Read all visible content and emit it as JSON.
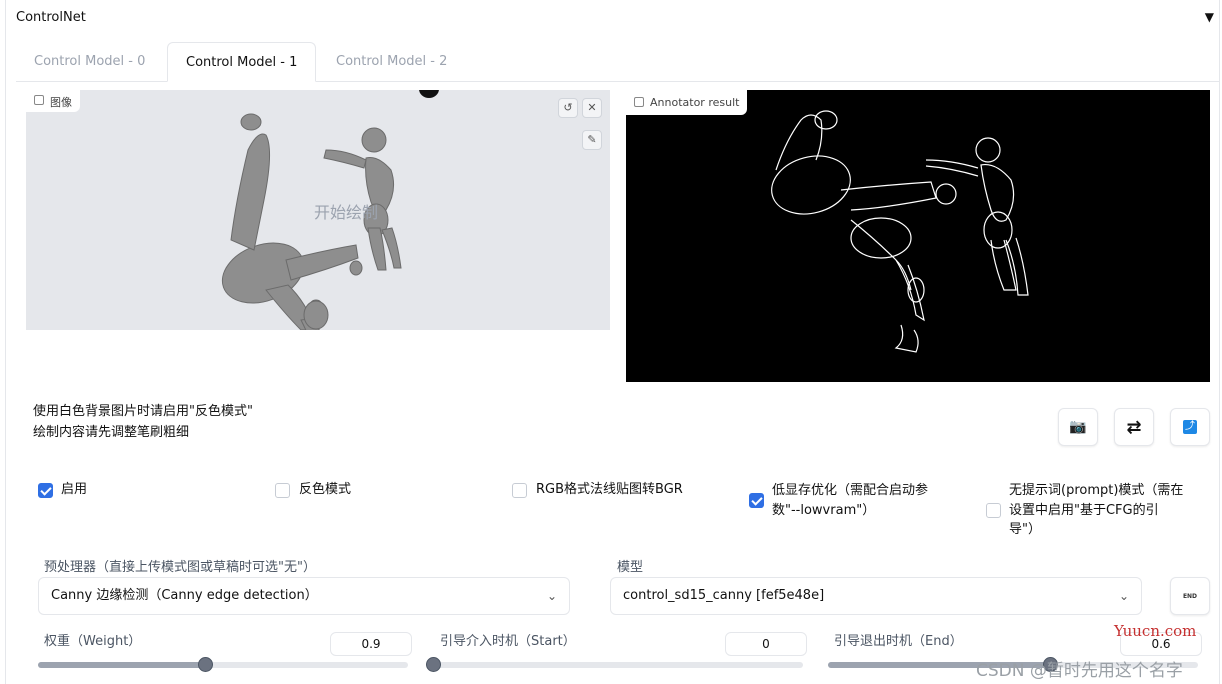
{
  "panel": {
    "title": "ControlNet",
    "collapse_arrow": "▼"
  },
  "tabs": [
    {
      "label": "Control Model - 0",
      "active": false
    },
    {
      "label": "Control Model - 1",
      "active": true
    },
    {
      "label": "Control Model - 2",
      "active": false
    }
  ],
  "image_input": {
    "label": "图像",
    "canvas_hint": "开始绘制",
    "buttons": {
      "undo": "↺",
      "clear": "✕",
      "brush": "✎"
    }
  },
  "annotator": {
    "label": "Annotator result"
  },
  "hints": {
    "line1": "使用白色背景图片时请启用\"反色模式\"",
    "line2": "绘制内容请先调整笔刷粗细"
  },
  "action_buttons": {
    "camera": "📷",
    "swap": "⇄",
    "send": "⤴"
  },
  "checkboxes": [
    {
      "label": "启用",
      "checked": true
    },
    {
      "label": "反色模式",
      "checked": false
    },
    {
      "label": "RGB格式法线贴图转BGR",
      "checked": false
    },
    {
      "label_line1": "低显存优化（需配合启动参",
      "label_line2": "数\"--lowvram\"）",
      "checked": true
    },
    {
      "label_line1": "无提示词(prompt)模式（需在",
      "label_line2": "设置中启用\"基于CFG的引",
      "label_line3": "导\"）",
      "checked": false
    }
  ],
  "preprocessor": {
    "label": "预处理器（直接上传模式图或草稿时可选\"无\"）",
    "value": "Canny 边缘检测（Canny edge detection）"
  },
  "model": {
    "label": "模型",
    "value": "control_sd15_canny [fef5e48e]",
    "refresh_icon": "END"
  },
  "sliders": {
    "weight": {
      "label": "权重（Weight）",
      "value": "0.9",
      "fraction": 0.45
    },
    "start": {
      "label": "引导介入时机（Start）",
      "value": "0",
      "fraction": 0.0
    },
    "end": {
      "label": "引导退出时机（End）",
      "value": "0.6",
      "fraction": 0.6
    }
  },
  "watermark": {
    "site": "Yuucn.com",
    "credit": "CSDN @暂时先用这个名字"
  },
  "colors": {
    "accent": "#2f6fe4",
    "canvas_bg": "#e5e7eb",
    "annotator_bg": "#000000"
  }
}
